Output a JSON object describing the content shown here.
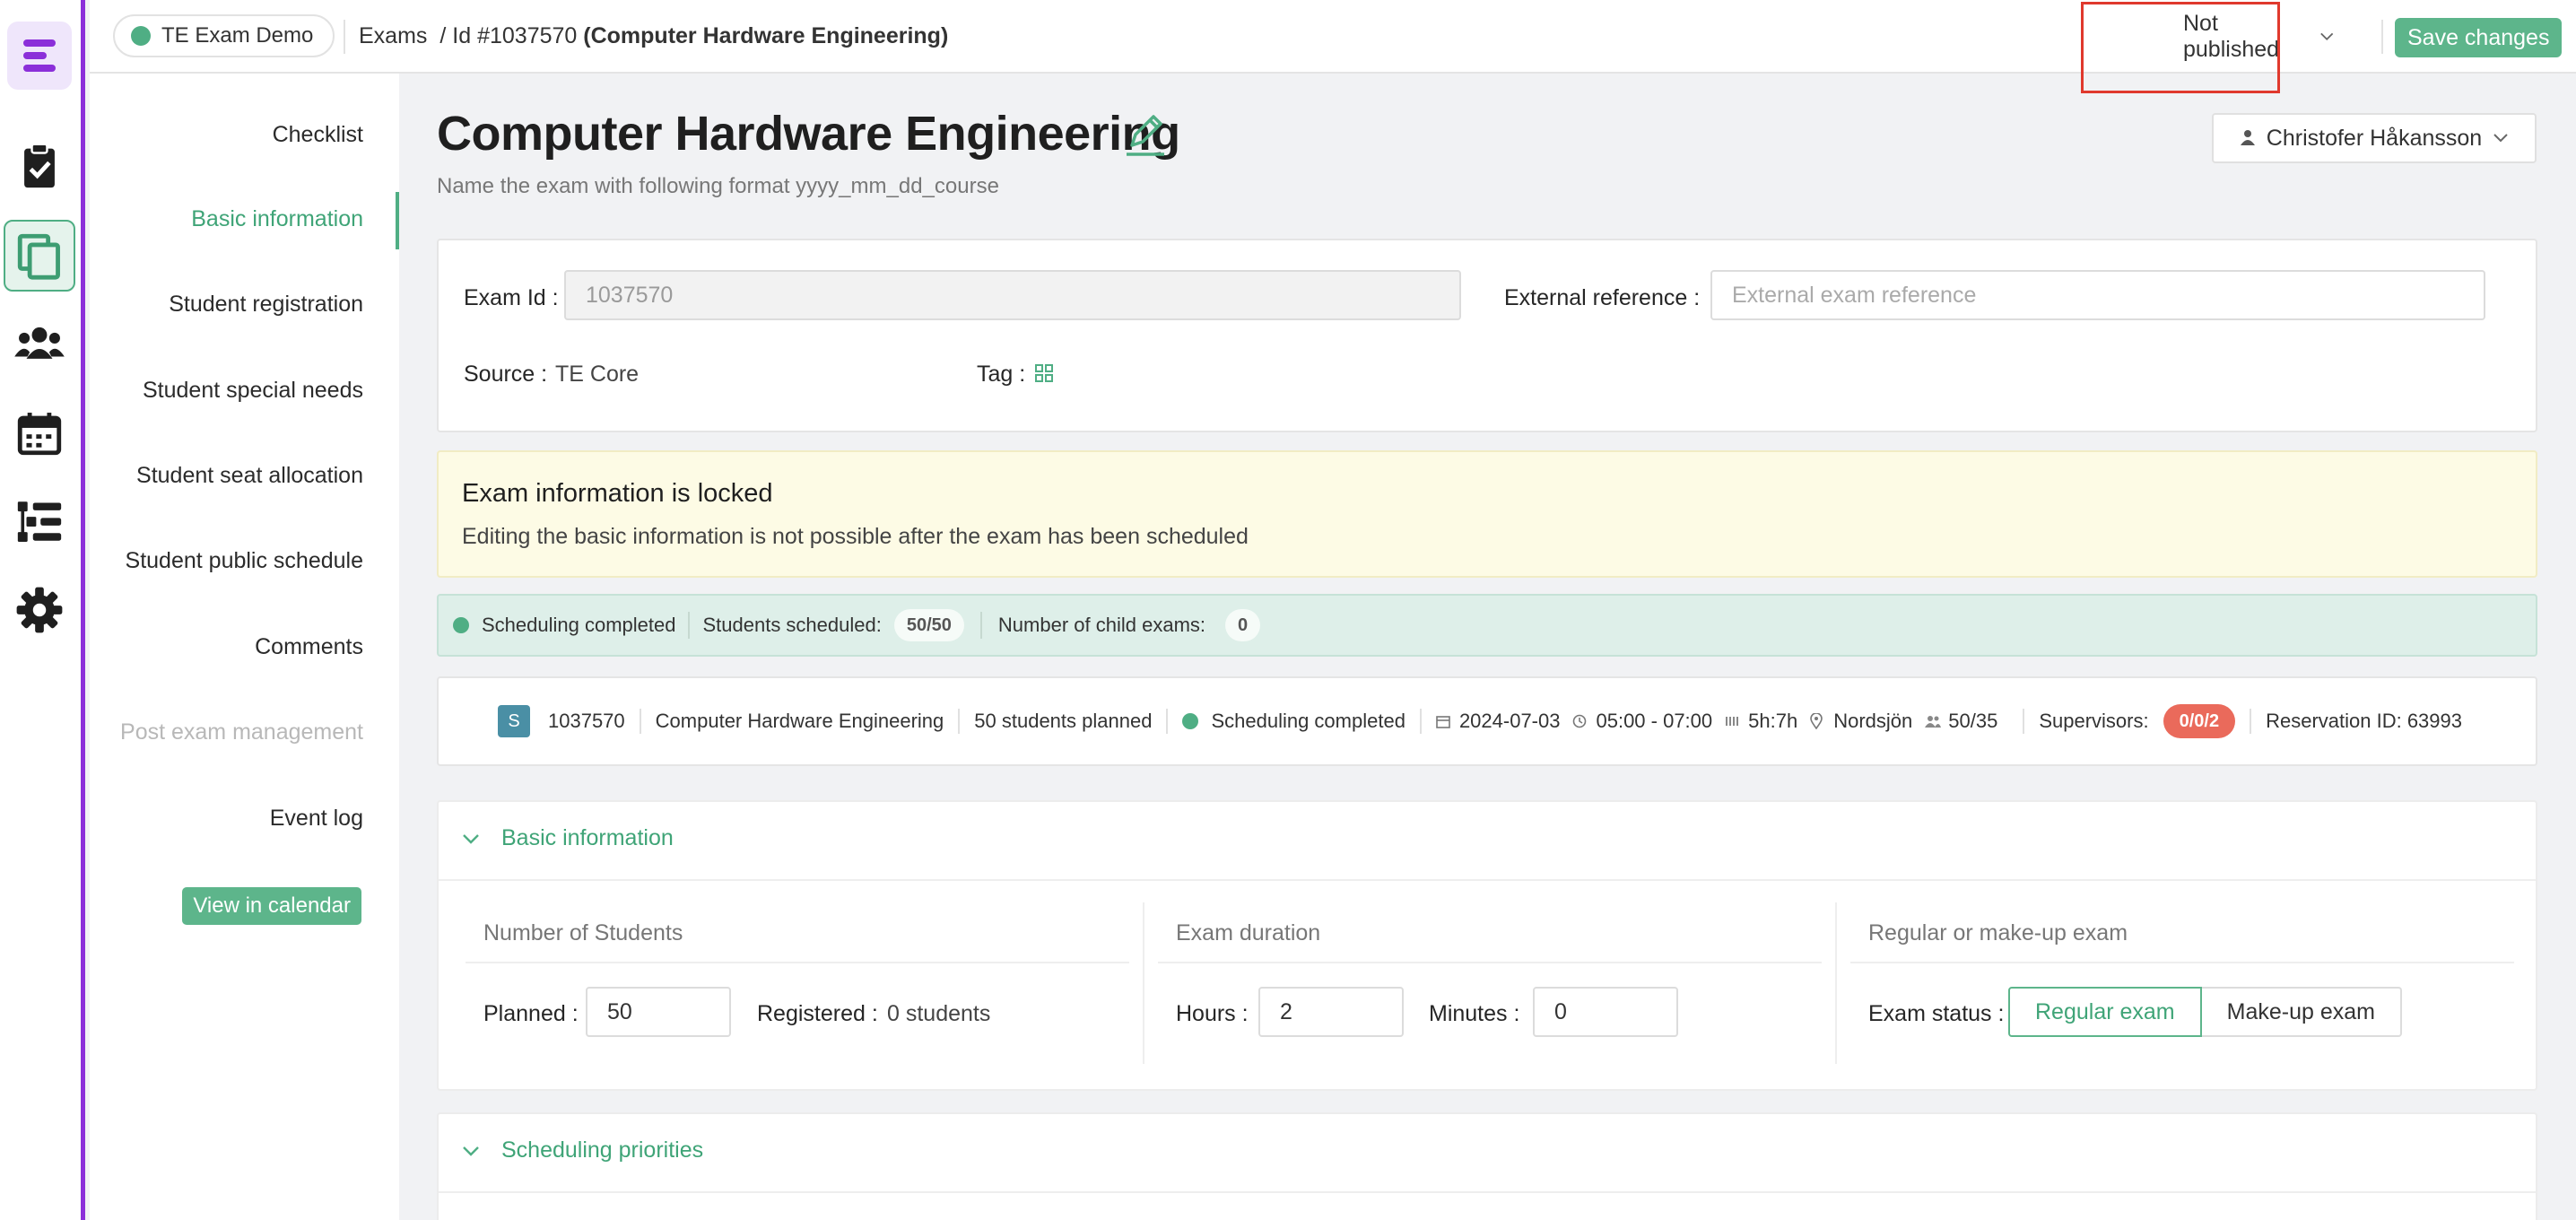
{
  "app": {
    "environment": "TE Exam Demo"
  },
  "breadcrumb": {
    "root": "Exams",
    "id_prefix": "/ Id #1037570",
    "exam_name": "(Computer Hardware Engineering)"
  },
  "topbar": {
    "status_value": "Not published",
    "save_label": "Save changes"
  },
  "sidebar": {
    "items": [
      {
        "label": "Checklist"
      },
      {
        "label": "Basic information"
      },
      {
        "label": "Student registration"
      },
      {
        "label": "Student special needs"
      },
      {
        "label": "Student seat allocation"
      },
      {
        "label": "Student public schedule"
      },
      {
        "label": "Comments"
      },
      {
        "label": "Post exam management"
      },
      {
        "label": "Event log"
      }
    ],
    "calendar_button": "View in calendar"
  },
  "page": {
    "title": "Computer Hardware Engineering",
    "subtitle": "Name the exam with following format yyyy_mm_dd_course",
    "owner": "Christofer Håkansson"
  },
  "exam_info": {
    "exam_id_label": "Exam Id :",
    "exam_id_value": "1037570",
    "external_ref_label": "External reference :",
    "external_ref_placeholder": "External exam reference",
    "source_label": "Source :",
    "source_value": "TE Core",
    "tag_label": "Tag :"
  },
  "locked_notice": {
    "title": "Exam information is locked",
    "text": "Editing the basic information is not possible after the exam has been scheduled"
  },
  "scheduling": {
    "status": "Scheduling completed",
    "students_label": "Students scheduled:",
    "students_value": "50/50",
    "child_label": "Number of child exams:",
    "child_value": "0"
  },
  "exam_row": {
    "badge": "S",
    "id": "1037570",
    "name": "Computer Hardware Engineering",
    "planned": "50 students planned",
    "status": "Scheduling completed",
    "date": "2024-07-03",
    "time": "05:00 - 07:00",
    "duration": "5h:7h",
    "room": "Nordsjön",
    "capacity": "50/35",
    "supervisors_label": "Supervisors:",
    "supervisors_value": "0/0/2",
    "reservation": "Reservation ID: 63993"
  },
  "basic_info": {
    "section_title": "Basic information",
    "students": {
      "title": "Number of Students",
      "planned_label": "Planned :",
      "planned_value": "50",
      "registered_label": "Registered :",
      "registered_value": "0 students"
    },
    "duration": {
      "title": "Exam duration",
      "hours_label": "Hours :",
      "hours_value": "2",
      "minutes_label": "Minutes :",
      "minutes_value": "0"
    },
    "exam_type": {
      "title": "Regular or make-up exam",
      "status_label": "Exam status :",
      "regular": "Regular exam",
      "makeup": "Make-up exam"
    }
  },
  "scheduling_priorities": {
    "section_title": "Scheduling priorities"
  },
  "colors": {
    "accent": "#4fae84",
    "brand": "#8b2fd9",
    "danger": "#ea6a5b",
    "highlight": "#e0392d"
  }
}
